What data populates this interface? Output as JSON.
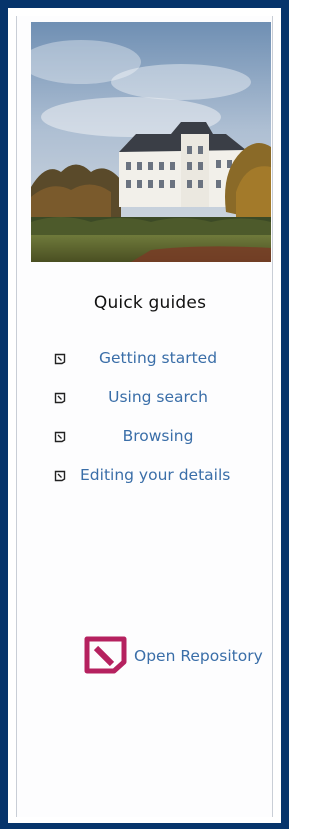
{
  "panel": {
    "photo_alt": "Campus building",
    "heading": "Quick guides"
  },
  "guides": [
    {
      "label": "Getting started",
      "icon": "guide-link-icon"
    },
    {
      "label": "Using search",
      "icon": "guide-link-icon"
    },
    {
      "label": "Browsing",
      "icon": "guide-link-icon"
    },
    {
      "label": "Editing your details",
      "icon": "guide-link-icon"
    }
  ],
  "footer": {
    "logo_label": "Open Repository",
    "logo_icon": "open-repository-logo"
  },
  "colors": {
    "frame": "#06346b",
    "link": "#3a6ea8",
    "logo": "#b5215f"
  }
}
